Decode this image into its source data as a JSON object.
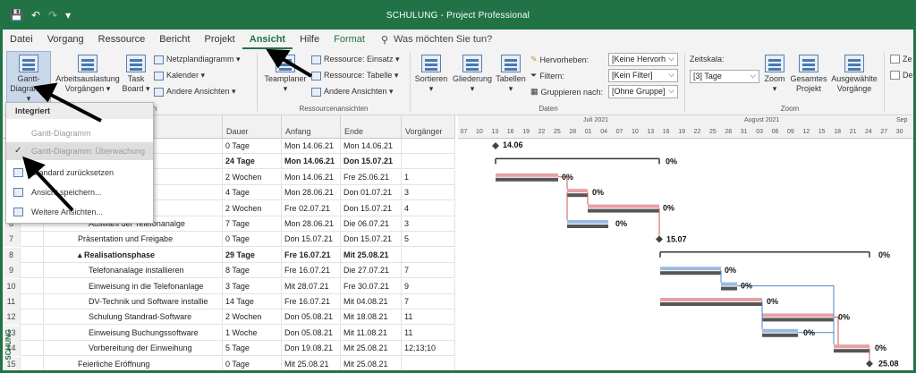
{
  "titlebar": {
    "title": "SCHULUNG  -  Project Professional",
    "save_icon": "💾",
    "undo_icon": "↶",
    "redo_icon": "↷",
    "qat_more": "▾"
  },
  "menu": {
    "items": [
      "Datei",
      "Vorgang",
      "Ressource",
      "Bericht",
      "Projekt",
      "Ansicht",
      "Hilfe",
      "Format"
    ],
    "search": "Was möchten Sie tun?"
  },
  "ribbon": {
    "gantt": "Gantt-\nDiagramm",
    "gantt_l1": "Gantt-",
    "gantt_l2": "Diagramm ▾",
    "arbeit_l1": "Arbeitsauslastung",
    "arbeit_l2": "Vorgängen ▾",
    "task_l1": "Task",
    "task_l2": "Board ▾",
    "netz": "Netzplandiagramm ▾",
    "kalender": "Kalender ▾",
    "andere": "Andere Ansichten ▾",
    "teamplaner": "Teamplaner",
    "teamplaner_arrow": "▾",
    "res_einsatz": "Ressource: Einsatz ▾",
    "res_tabelle": "Ressource: Tabelle ▾",
    "andere2": "Andere Ansichten ▾",
    "ressourcenansichten": "Ressourcenansichten",
    "sortieren": "Sortieren",
    "gliederung": "Gliederung",
    "tabellen": "Tabellen",
    "sort_arrow": "▾",
    "hervorheben": "Hervorheben:",
    "hervor_value": "[Keine Hervorh",
    "filtern": "Filtern:",
    "filter_value": "[Kein Filter]",
    "gruppieren": "Gruppieren nach:",
    "gruppe_value": "[Ohne Gruppe]",
    "daten": "Daten",
    "zeitskala": "Zeitskala:",
    "zeitskala_value": "[3] Tage",
    "zoom": "Zoom",
    "gesamtes_l1": "Gesamtes",
    "gesamtes_l2": "Projekt",
    "ausgew_l1": "Ausgewählte",
    "ausgew_l2": "Vorgänge",
    "zoom_group": "Zoom",
    "ze": "Ze",
    "de": "De",
    "group_left": "n"
  },
  "dropdown": {
    "header": "Integriert",
    "item1": "Gantt-Diagramm",
    "item2": "Gantt-Diagramm: Überwachung",
    "item3": "Standard zurücksetzen",
    "item4": "Ansicht speichern...",
    "item5": "Weitere Ansichten...",
    "check": "✓"
  },
  "table": {
    "headers": {
      "dauer": "Dauer",
      "anfang": "Anfang",
      "ende": "Ende",
      "vorg": "Vorgänger"
    },
    "rows": [
      {
        "n": "",
        "name": "",
        "dauer": "0 Tage",
        "anfang": "Mon 14.06.21",
        "ende": "Mon 14.06.21",
        "vorg": "",
        "bold": false
      },
      {
        "n": "",
        "name": "",
        "dauer": "24 Tage",
        "anfang": "Mon 14.06.21",
        "ende": "Don 15.07.21",
        "vorg": "",
        "bold": true
      },
      {
        "n": "",
        "name": "hnik und DV",
        "dauer": "2 Wochen",
        "anfang": "Mon 14.06.21",
        "ende": "Fre 25.06.21",
        "vorg": "1",
        "bold": false
      },
      {
        "n": "",
        "name": "",
        "dauer": "4 Tage",
        "anfang": "Mon 28.06.21",
        "ende": "Don 01.07.21",
        "vorg": "3",
        "bold": false
      },
      {
        "n": "",
        "name": "ion",
        "dauer": "2 Wochen",
        "anfang": "Fre 02.07.21",
        "ende": "Don 15.07.21",
        "vorg": "4",
        "bold": false
      },
      {
        "n": "6",
        "name": "Auswahl der Telefonanalge",
        "dauer": "7 Tage",
        "anfang": "Mon 28.06.21",
        "ende": "Die 06.07.21",
        "vorg": "3",
        "bold": false
      },
      {
        "n": "7",
        "name": "Präsentation und Freigabe",
        "dauer": "0 Tage",
        "anfang": "Don 15.07.21",
        "ende": "Don 15.07.21",
        "vorg": "5",
        "bold": false
      },
      {
        "n": "8",
        "name": "▴ Realisationsphase",
        "dauer": "29 Tage",
        "anfang": "Fre 16.07.21",
        "ende": "Mit 25.08.21",
        "vorg": "",
        "bold": true
      },
      {
        "n": "9",
        "name": "Telefonanalage installieren",
        "dauer": "8 Tage",
        "anfang": "Fre 16.07.21",
        "ende": "Die 27.07.21",
        "vorg": "7",
        "bold": false
      },
      {
        "n": "10",
        "name": "Einweisung in die Telefonanlage",
        "dauer": "3 Tage",
        "anfang": "Mit 28.07.21",
        "ende": "Fre 30.07.21",
        "vorg": "9",
        "bold": false
      },
      {
        "n": "11",
        "name": "DV-Technik und Software installie",
        "dauer": "14 Tage",
        "anfang": "Fre 16.07.21",
        "ende": "Mit 04.08.21",
        "vorg": "7",
        "bold": false
      },
      {
        "n": "12",
        "name": "Schulung Standrad-Software",
        "dauer": "2 Wochen",
        "anfang": "Don 05.08.21",
        "ende": "Mit 18.08.21",
        "vorg": "11",
        "bold": false
      },
      {
        "n": "13",
        "name": "Einweisung Buchungssoftware",
        "dauer": "1 Woche",
        "anfang": "Don 05.08.21",
        "ende": "Mit 11.08.21",
        "vorg": "11",
        "bold": false
      },
      {
        "n": "14",
        "name": "Vorbereitung der Einweihung",
        "dauer": "5 Tage",
        "anfang": "Don 19.08.21",
        "ende": "Mit 25.08.21",
        "vorg": "12;13;10",
        "bold": false
      },
      {
        "n": "15",
        "name": "Feierliche Eröffnung",
        "dauer": "0 Tage",
        "anfang": "Mit 25.08.21",
        "ende": "Mit 25.08.21",
        "vorg": "",
        "bold": false
      }
    ]
  },
  "timeline": {
    "month_jul": "Juli 2021",
    "month_aug": "August 2021",
    "month_sep": "Sep",
    "days": [
      "07",
      "10",
      "13",
      "16",
      "19",
      "22",
      "25",
      "28",
      "01",
      "04",
      "07",
      "10",
      "13",
      "16",
      "19",
      "22",
      "25",
      "28",
      "31",
      "03",
      "06",
      "09",
      "12",
      "15",
      "18",
      "21",
      "24",
      "27",
      "30"
    ]
  },
  "gantt_labels": {
    "m1": "14.06",
    "p2": "0%",
    "p3": "0%",
    "p4": "0%",
    "p5": "0%",
    "p6": "0%",
    "m7": "15.07",
    "p8": "0%",
    "p9": "0%",
    "p10": "0%",
    "p11": "0%",
    "p12": "0%",
    "p13": "0%",
    "p14": "0%",
    "m15": "25.08"
  },
  "side": {
    "vertical": "SCHUNG"
  }
}
